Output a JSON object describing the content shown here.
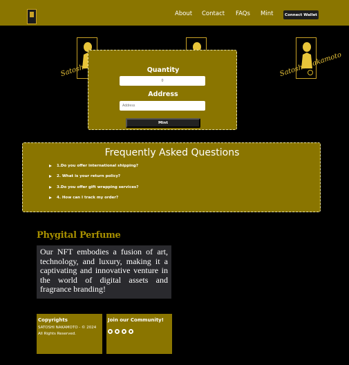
{
  "header": {
    "nav": [
      "About",
      "Contact",
      "FAQs",
      "Mint"
    ],
    "connect_label": "Connect Wallet"
  },
  "mint": {
    "quantity_label": "Quantity",
    "quantity_value": "0",
    "address_label": "Address",
    "address_placeholder": "Address",
    "mint_label": "Mint"
  },
  "faq": {
    "title": "Frequently Asked Questions",
    "items": [
      "1.Do you offer international shipping?",
      "2. What is your return policy?",
      "3.Do you offer gift wrapping services?",
      "4. How can I track my order?"
    ]
  },
  "perfume": {
    "title": "Phygital Perfume",
    "text": "Our NFT embodies a fusion of art, technology, and luxury, making it a captivating and innovative venture in the world of digital assets and fragrance branding!"
  },
  "footer": {
    "copyright_title": "Copyrights",
    "copyright_text": "SATOSHI NAKAMOTO - © 2024 All Rights Reserved.",
    "community_title": "Join our Community!",
    "socials": [
      "facebook-icon",
      "instagram-icon",
      "twitter-icon",
      "linkedin-icon"
    ]
  },
  "decor": {
    "signature": "Satoshi Nakamoto"
  },
  "colors": {
    "gold": "#8a7500",
    "background": "#000000",
    "dark_box": "#2a2a2e"
  }
}
